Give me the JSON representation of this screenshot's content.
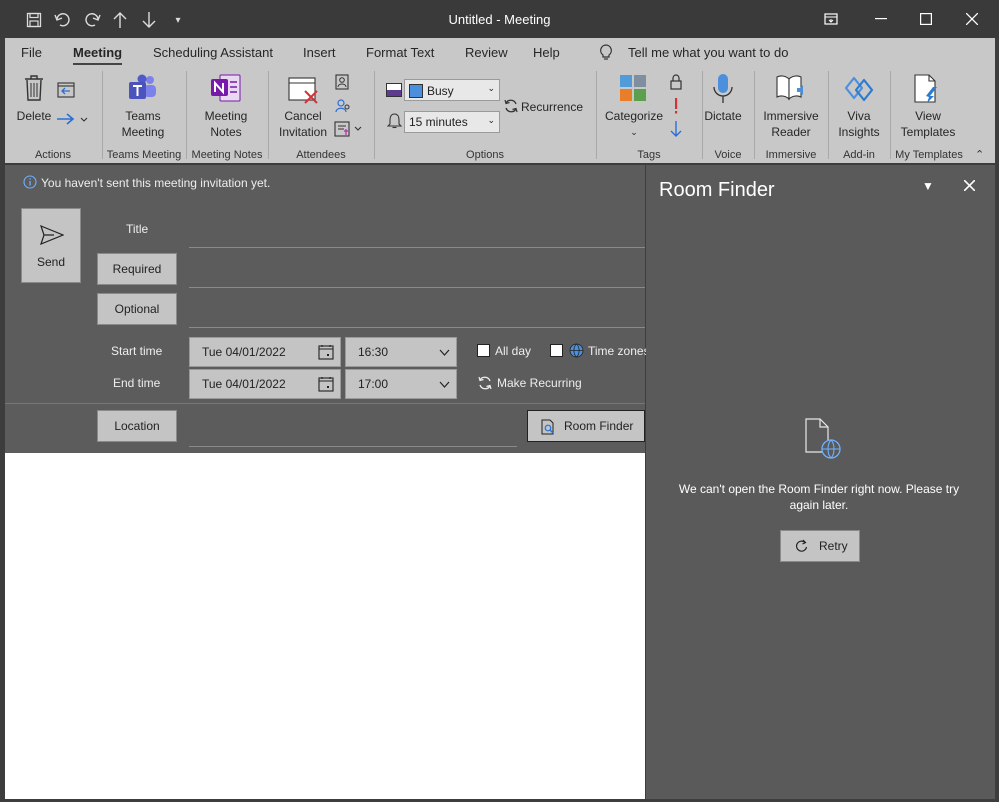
{
  "window": {
    "title": "Untitled  -  Meeting"
  },
  "menu": [
    "File",
    "Meeting",
    "Scheduling Assistant",
    "Insert",
    "Format Text",
    "Review",
    "Help"
  ],
  "tell_me": "Tell me what you want to do",
  "ribbon": {
    "delete": "Delete",
    "teams_meeting": [
      "Teams",
      "Meeting"
    ],
    "meeting_notes": [
      "Meeting",
      "Notes"
    ],
    "cancel_invitation": [
      "Cancel",
      "Invitation"
    ],
    "show_as": "Busy",
    "reminder": "15 minutes",
    "recurrence": "Recurrence",
    "categorize": "Categorize",
    "dictate": "Dictate",
    "immersive_reader": [
      "Immersive",
      "Reader"
    ],
    "viva_insights": [
      "Viva",
      "Insights"
    ],
    "view_templates": [
      "View",
      "Templates"
    ],
    "groups": [
      "Actions",
      "Teams Meeting",
      "Meeting Notes",
      "Attendees",
      "Options",
      "Tags",
      "Voice",
      "Immersive",
      "Add-in",
      "My Templates"
    ]
  },
  "form": {
    "info": "You haven't sent this meeting invitation yet.",
    "send": "Send",
    "title_label": "Title",
    "required": "Required",
    "optional": "Optional",
    "start_label": "Start time",
    "end_label": "End time",
    "start_date": "Tue 04/01/2022",
    "start_time": "16:30",
    "end_date": "Tue 04/01/2022",
    "end_time": "17:00",
    "all_day": "All day",
    "time_zones": "Time zones",
    "make_recurring": "Make Recurring",
    "location": "Location",
    "room_finder": "Room Finder"
  },
  "room_finder": {
    "title": "Room Finder",
    "message": "We can't open the Room Finder right now. Please try again later.",
    "retry": "Retry"
  }
}
